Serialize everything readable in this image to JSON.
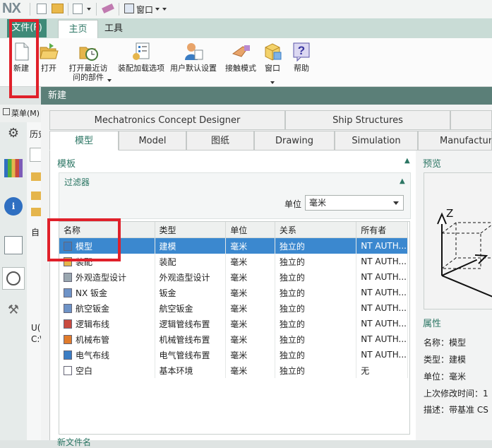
{
  "app": {
    "logo": "NX",
    "window_menu": "窗口"
  },
  "tabs": {
    "file": "文件(F)",
    "home": "主页",
    "tools": "工具"
  },
  "ribbon": [
    {
      "label": "新建",
      "icon": "new-file-icon"
    },
    {
      "label": "打开",
      "icon": "open-folder-icon"
    },
    {
      "label": "打开最近访问的部件",
      "icon": "recent-parts-icon"
    },
    {
      "label": "装配加载选项",
      "icon": "assembly-load-options-icon"
    },
    {
      "label": "用户默认设置",
      "icon": "user-defaults-icon"
    },
    {
      "label": "接触模式",
      "icon": "touch-mode-icon"
    },
    {
      "label": "窗口",
      "icon": "window-icon"
    },
    {
      "label": "帮助",
      "icon": "help-icon"
    }
  ],
  "left": {
    "menu_label": "菜单(M)",
    "history_label": "历史",
    "bottom_text_1": "U(",
    "bottom_text_2": "C:\\"
  },
  "dialog": {
    "title": "新建",
    "tabs_row1": [
      "Mechatronics Concept Designer",
      "Ship Structures"
    ],
    "tabs_row2": [
      "模型",
      "Model",
      "图纸",
      "Drawing",
      "Simulation",
      "Manufacturing"
    ],
    "templates_title": "模板",
    "filter_title": "过滤器",
    "unit_label": "单位",
    "unit_value": "毫米",
    "preview_title": "预览",
    "properties_title": "属性",
    "columns": [
      "名称",
      "类型",
      "单位",
      "关系",
      "所有者"
    ],
    "rows": [
      {
        "name": "模型",
        "type": "建模",
        "unit": "毫米",
        "relation": "独立的",
        "owner": "NT AUTH...",
        "icon": "model-icon"
      },
      {
        "name": "装配",
        "type": "装配",
        "unit": "毫米",
        "relation": "独立的",
        "owner": "NT AUTH...",
        "icon": "assembly-icon"
      },
      {
        "name": "外观造型设计",
        "type": "外观造型设计",
        "unit": "毫米",
        "relation": "独立的",
        "owner": "NT AUTH...",
        "icon": "shape-studio-icon"
      },
      {
        "name": "NX 钣金",
        "type": "钣金",
        "unit": "毫米",
        "relation": "独立的",
        "owner": "NT AUTH...",
        "icon": "sheet-metal-icon"
      },
      {
        "name": "航空钣金",
        "type": "航空钣金",
        "unit": "毫米",
        "relation": "独立的",
        "owner": "NT AUTH...",
        "icon": "aero-sheet-metal-icon"
      },
      {
        "name": "逻辑布线",
        "type": "逻辑管线布置",
        "unit": "毫米",
        "relation": "独立的",
        "owner": "NT AUTH...",
        "icon": "logical-routing-icon"
      },
      {
        "name": "机械布管",
        "type": "机械管线布置",
        "unit": "毫米",
        "relation": "独立的",
        "owner": "NT AUTH...",
        "icon": "mechanical-routing-icon"
      },
      {
        "name": "电气布线",
        "type": "电气管线布置",
        "unit": "毫米",
        "relation": "独立的",
        "owner": "NT AUTH...",
        "icon": "electrical-routing-icon"
      },
      {
        "name": "空白",
        "type": "基本环境",
        "unit": "毫米",
        "relation": "独立的",
        "owner": "无",
        "icon": "blank-icon"
      }
    ],
    "properties": [
      {
        "label": "名称：",
        "value": "模型"
      },
      {
        "label": "类型：",
        "value": "建模"
      },
      {
        "label": "单位：",
        "value": "毫米"
      },
      {
        "label": "上次修改时间：",
        "value": "1"
      },
      {
        "label": "描述：",
        "value": "带基准 CS"
      }
    ],
    "bottom_section": "新文件名"
  }
}
